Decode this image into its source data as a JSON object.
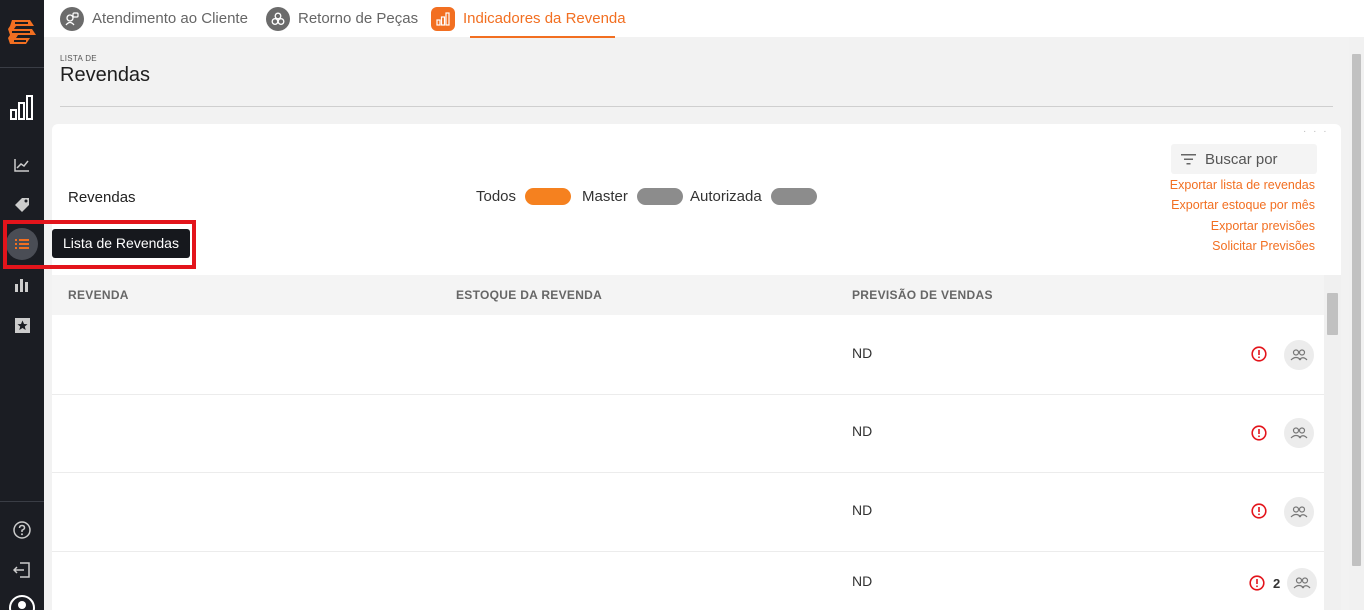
{
  "tabs": [
    {
      "label": "Atendimento ao Cliente",
      "icon": "customer-service-icon"
    },
    {
      "label": "Retorno de Peças",
      "icon": "parts-return-icon"
    },
    {
      "label": "Indicadores da Revenda",
      "icon": "bar-chart-icon"
    }
  ],
  "tooltip": "Lista de Revendas",
  "page": {
    "kicker": "LISTA DE",
    "title": "Revendas"
  },
  "card": {
    "title": "Revendas",
    "filters": [
      {
        "label": "Todos",
        "on": true
      },
      {
        "label": "Master",
        "on": false
      },
      {
        "label": "Autorizada",
        "on": false
      }
    ],
    "search_label": "Buscar por",
    "links": [
      "Exportar lista de revendas",
      "Exportar estoque por mês",
      "Exportar previsões",
      "Solicitar Previsões"
    ]
  },
  "table": {
    "headers": [
      "REVENDA",
      "ESTOQUE DA REVENDA",
      "PREVISÃO DE VENDAS"
    ],
    "rows": [
      {
        "revenda": "",
        "estoque": "",
        "previsao": "ND",
        "count": ""
      },
      {
        "revenda": "",
        "estoque": "",
        "previsao": "ND",
        "count": ""
      },
      {
        "revenda": "",
        "estoque": "",
        "previsao": "ND",
        "count": ""
      },
      {
        "revenda": "",
        "estoque": "",
        "previsao": "ND",
        "count": "2"
      }
    ]
  },
  "colors": {
    "accent": "#f26f21",
    "sidebar": "#1b1d23",
    "highlight": "#e3141b",
    "alert": "#e3141b"
  }
}
